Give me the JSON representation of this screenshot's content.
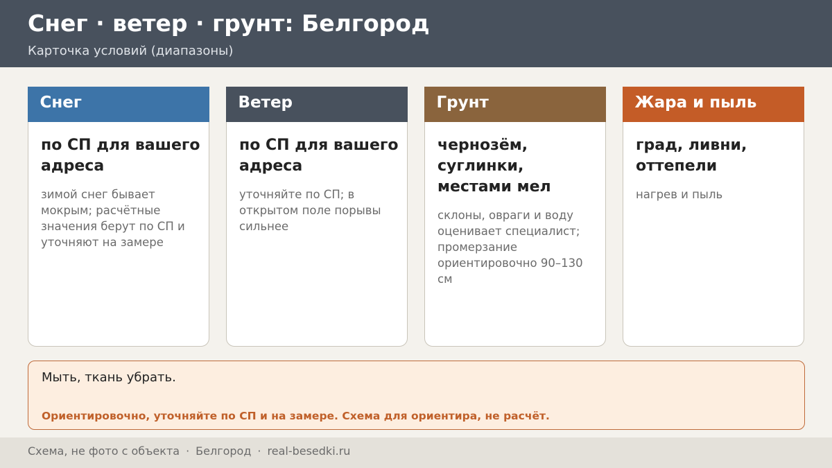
{
  "header": {
    "title": "Снег · ветер · грунт: Белгород",
    "subtitle": "Карточка условий (диапазоны)"
  },
  "cards": [
    {
      "title": "Снег",
      "color": "#3d74a8",
      "main": "по СП для вашего адреса",
      "note": "зимой снег бывает мокрым; расчётные значения берут по СП и уточняют на замере"
    },
    {
      "title": "Ветер",
      "color": "#48515d",
      "main": "по СП для вашего адреса",
      "note": "уточняйте по СП; в открытом поле порывы сильнее"
    },
    {
      "title": "Грунт",
      "color": "#8a643d",
      "main": "чернозём, суглинки, местами мел",
      "note": "склоны, овраги и воду оценивает специалист; промерзание ориентировочно 90–130 см"
    },
    {
      "title": "Жара и пыль",
      "color": "#c45c27",
      "main": "град, ливни, оттепели",
      "note": "нагрев и пыль"
    }
  ],
  "note_box": {
    "text": "Мыть, ткань убрать.",
    "warning": "Ориентировочно, уточняйте по СП и на замере. Схема для ориентира, не расчёт."
  },
  "footer": {
    "part1": "Схема, не фото с объекта",
    "separator": "·",
    "part2": "Белгород",
    "part3": "real-besedki.ru"
  }
}
